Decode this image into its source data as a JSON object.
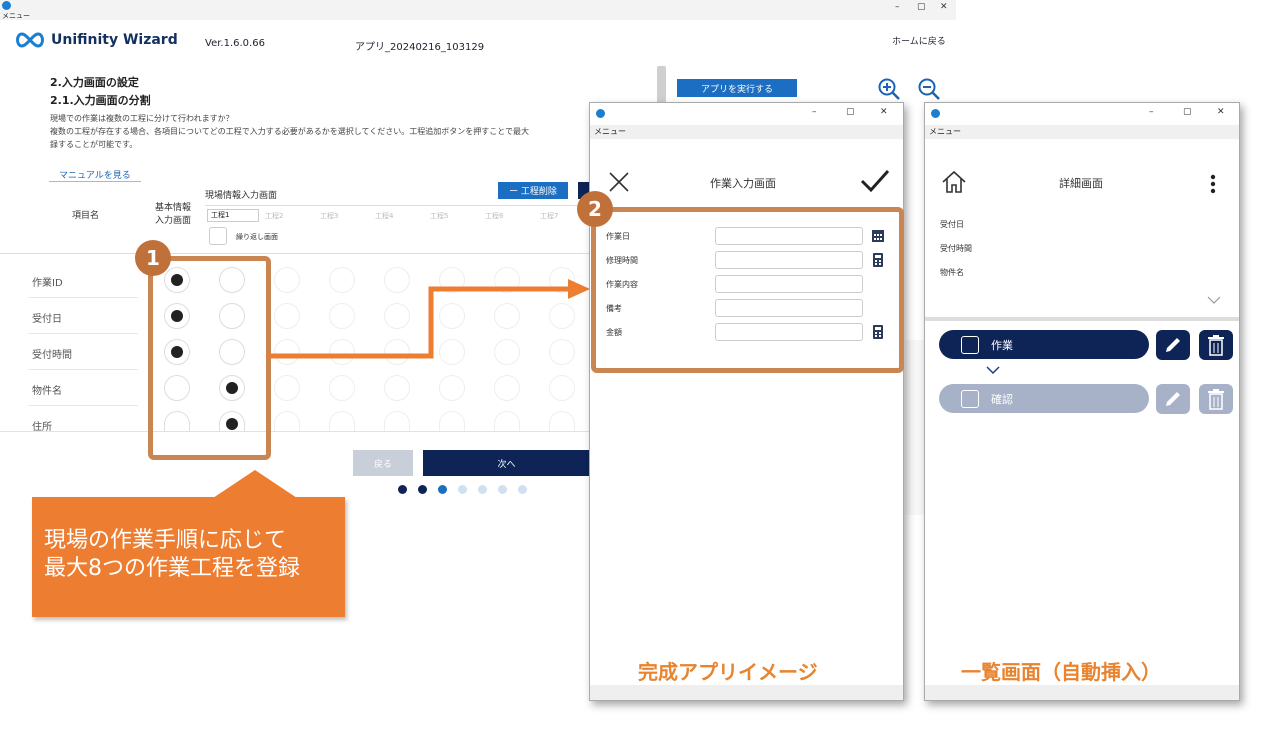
{
  "main_window": {
    "title": "メニュー",
    "window_controls": [
      "–",
      "▢",
      "✕"
    ]
  },
  "header": {
    "logo_text": "Unifinity Wizard",
    "version": "Ver.1.6.0.66",
    "app_name": "アプリ_20240216_103129",
    "home_link": "ホームに戻る"
  },
  "section": {
    "title": "2.入力画面の設定",
    "subtitle": "2.1.入力画面の分割",
    "desc_line1": "現場での作業は複数の工程に分けて行われますか？",
    "desc_line2": "複数の工程が存在する場合、各項目についてどの工程で入力する必要があるかを選択してください。工程追加ボタンを押すことで最大",
    "desc_line3": "録することが可能です。",
    "manual_link": "マニュアルを見る"
  },
  "toolbar": {
    "run_app": "アプリを実行する",
    "delete_step": "ー 工程削除"
  },
  "table": {
    "col_item": "項目名",
    "col_basic_line1": "基本情報",
    "col_basic_line2": "入力画面",
    "site_screen_label": "現場情報入力画面",
    "steps": [
      "工程1",
      "工程2",
      "工程3",
      "工程4",
      "工程5",
      "工程6",
      "工程7"
    ],
    "repeat_label": "繰り返し画面",
    "rows": [
      {
        "label": "作業ID",
        "basic": true,
        "step1": false
      },
      {
        "label": "受付日",
        "basic": true,
        "step1": false
      },
      {
        "label": "受付時間",
        "basic": true,
        "step1": false
      },
      {
        "label": "物件名",
        "basic": false,
        "step1": true
      },
      {
        "label": "住所",
        "basic": false,
        "step1": true
      }
    ]
  },
  "nav": {
    "back": "戻る",
    "next": "次へ",
    "pager_active": 3,
    "pager_total": 7
  },
  "callouts": {
    "badge1": "1",
    "badge2": "2",
    "note_line1": "現場の作業手順に応じて",
    "note_line2": "最大8つの作業工程を登録"
  },
  "work_input_window": {
    "menu": "メニュー",
    "title": "作業入力画面",
    "fields": [
      {
        "label": "作業日",
        "icon": "calendar-icon"
      },
      {
        "label": "修理時間",
        "icon": "calculator-icon"
      },
      {
        "label": "作業内容",
        "icon": ""
      },
      {
        "label": "備考",
        "icon": ""
      },
      {
        "label": "金額",
        "icon": "calculator-icon"
      }
    ],
    "caption": "完成アプリイメージ"
  },
  "detail_window": {
    "menu": "メニュー",
    "title": "詳細画面",
    "fields": [
      "受付日",
      "受付時間",
      "物件名"
    ],
    "steps": [
      {
        "label": "作業",
        "enabled": true
      },
      {
        "label": "確認",
        "enabled": false
      }
    ],
    "caption": "一覧画面（自動挿入）"
  },
  "colors": {
    "navy": "#0e2457",
    "accent_blue": "#1b6ec2",
    "callout_orange": "#ed7d31",
    "outline_orange": "#c98652",
    "caption_orange": "#e8832f"
  }
}
